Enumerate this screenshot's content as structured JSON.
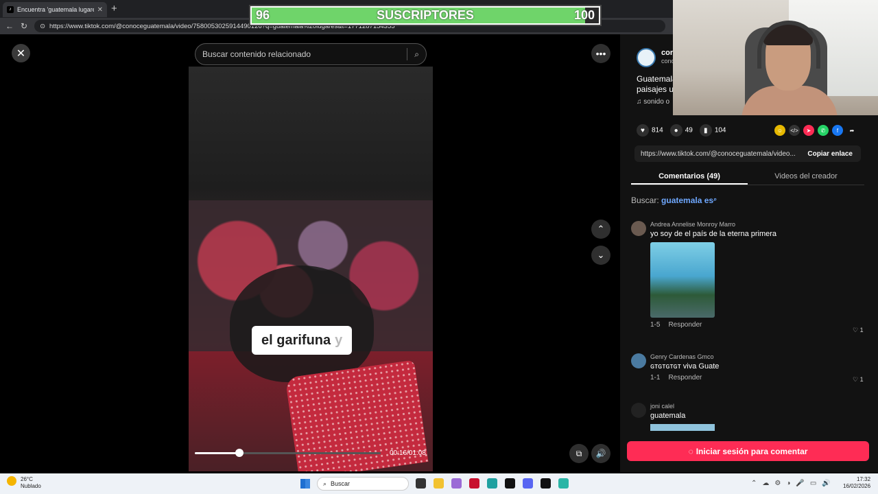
{
  "browser": {
    "tab_title": "Encuentra 'guatemala lugares…",
    "url": "https://www.tiktok.com/@conoceguatemala/video/7580053025914490126?q=guatemala%20lugares&t=1771287154355"
  },
  "overlay": {
    "left_count": "96",
    "label": "SUSCRIPTORES",
    "right_count": "100",
    "progress": 0.96
  },
  "video": {
    "search_placeholder": "Buscar contenido relacionado",
    "caption_main": "el garifuna",
    "caption_next": "y",
    "time": "00:16/01:08",
    "progress": 0.24
  },
  "post": {
    "author_name": "cor",
    "author_sub": "cono",
    "desc_line1": "Guatemala",
    "desc_line2": "paisajes ur",
    "sound": "sonido o",
    "likes": "814",
    "comments": "49",
    "saves": "104",
    "link": "https://www.tiktok.com/@conoceguatemala/video...",
    "copy_label": "Copiar enlace"
  },
  "tabs": {
    "comments": "Comentarios (49)",
    "creator": "Videos del creador"
  },
  "search_hint": {
    "label": "Buscar:",
    "query": "guatemala es"
  },
  "comments": [
    {
      "user": "Andrea Annelise Monroy Marro",
      "text": "yo soy de el país de la eterna primera",
      "date": "1-5",
      "reply": "Responder",
      "likes": "1"
    },
    {
      "user": "Genry Cardenas Gmco",
      "text": "ɢᴛɢᴛɢᴛɢᴛ viva Guate",
      "date": "1-1",
      "reply": "Responder",
      "likes": "1"
    },
    {
      "user": "joni calel",
      "text": "guatemala"
    }
  ],
  "login_label": "Iniciar sesión para comentar",
  "taskbar": {
    "temp": "26°C",
    "weather": "Nublado",
    "search": "Buscar",
    "time": "17:32",
    "date": "16/02/2026"
  }
}
